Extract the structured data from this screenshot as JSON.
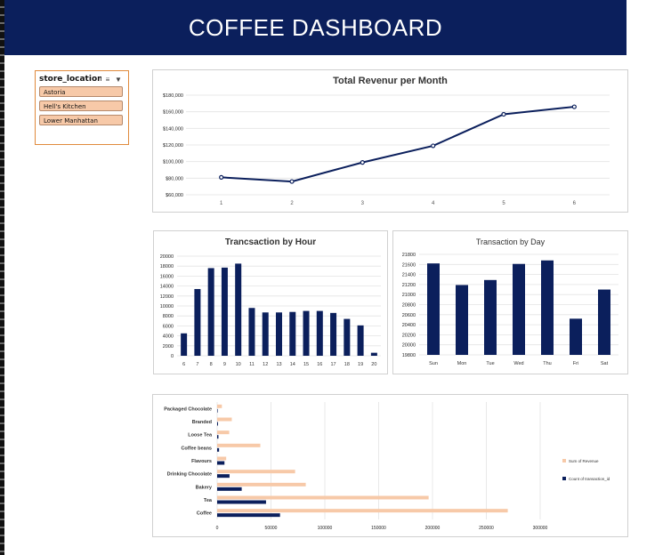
{
  "header": {
    "title": "COFFEE DASHBOARD"
  },
  "slicer": {
    "title": "store_location",
    "multiselect_icon": "multi-select-icon",
    "clear_icon": "clear-filter-icon",
    "items": [
      {
        "label": "Astoria"
      },
      {
        "label": "Hell's Kitchen"
      },
      {
        "label": "Lower Manhattan"
      }
    ]
  },
  "colors": {
    "navy": "#0b1f5c",
    "peach": "#f7c9a8",
    "slicer_border": "#e08a3c"
  },
  "chart_data": [
    {
      "type": "line",
      "title": "Total Revenur per Month",
      "x": [
        1,
        2,
        3,
        4,
        5,
        6
      ],
      "values": [
        81000,
        76000,
        99000,
        119000,
        157000,
        166000
      ],
      "ylim": [
        60000,
        180000
      ],
      "yticks": [
        60000,
        80000,
        100000,
        120000,
        140000,
        160000,
        180000
      ],
      "ytick_labels": [
        "$60,000",
        "$80,000",
        "$100,000",
        "$120,000",
        "$140,000",
        "$160,000",
        "$180,000"
      ],
      "grid": true,
      "legend": "none",
      "color": "#0b1f5c"
    },
    {
      "type": "bar",
      "title": "Trancsaction by Hour",
      "categories": [
        "6",
        "7",
        "8",
        "9",
        "10",
        "11",
        "12",
        "13",
        "14",
        "15",
        "16",
        "17",
        "18",
        "19",
        "20"
      ],
      "values": [
        4500,
        13400,
        17600,
        17700,
        18500,
        9600,
        8700,
        8700,
        8800,
        9000,
        9000,
        8600,
        7400,
        6100,
        600
      ],
      "ylim": [
        0,
        20000
      ],
      "yticks": [
        0,
        2000,
        4000,
        6000,
        8000,
        10000,
        12000,
        14000,
        16000,
        18000,
        20000
      ],
      "ytick_labels": [
        "0",
        "2000",
        "4000",
        "6000",
        "8000",
        "10000",
        "12000",
        "14000",
        "16000",
        "18000",
        "20000"
      ],
      "grid": true,
      "legend": "none",
      "color": "#0b1f5c"
    },
    {
      "type": "bar",
      "title": "Transaction by Day",
      "categories": [
        "Sun",
        "Mon",
        "Tue",
        "Wed",
        "Thu",
        "Fri",
        "Sat"
      ],
      "values": [
        21620,
        21190,
        21290,
        21610,
        21680,
        20520,
        21100
      ],
      "ylim": [
        19800,
        21800
      ],
      "yticks": [
        19800,
        20000,
        20200,
        20400,
        20600,
        20800,
        21000,
        21200,
        21400,
        21600,
        21800
      ],
      "ytick_labels": [
        "19800",
        "20000",
        "20200",
        "20400",
        "20600",
        "20800",
        "21000",
        "21200",
        "21400",
        "21600",
        "21800"
      ],
      "grid": true,
      "legend": "none",
      "color": "#0b1f5c"
    },
    {
      "type": "bar",
      "orientation": "horizontal",
      "title": "",
      "categories": [
        "Coffee",
        "Tea",
        "Bakery",
        "Drinking Chocolate",
        "Flavours",
        "Coffee beans",
        "Loose Tea",
        "Branded",
        "Packaged Chocolate"
      ],
      "series": [
        {
          "name": "Sum of Revenue",
          "values": [
            269900,
            196400,
            82300,
            72400,
            8400,
            40100,
            11200,
            13600,
            4400
          ],
          "color": "#f7c9a8"
        },
        {
          "name": "Count of transaction_id",
          "values": [
            58400,
            45400,
            22800,
            11500,
            6800,
            1800,
            1200,
            800,
            500
          ],
          "color": "#0b1f5c"
        }
      ],
      "xlim": [
        0,
        300000
      ],
      "xticks": [
        0,
        50000,
        100000,
        150000,
        200000,
        250000,
        300000
      ],
      "xtick_labels": [
        "0",
        "50000",
        "100000",
        "150000",
        "200000",
        "250000",
        "300000"
      ],
      "grid": true,
      "legend": "right"
    }
  ]
}
